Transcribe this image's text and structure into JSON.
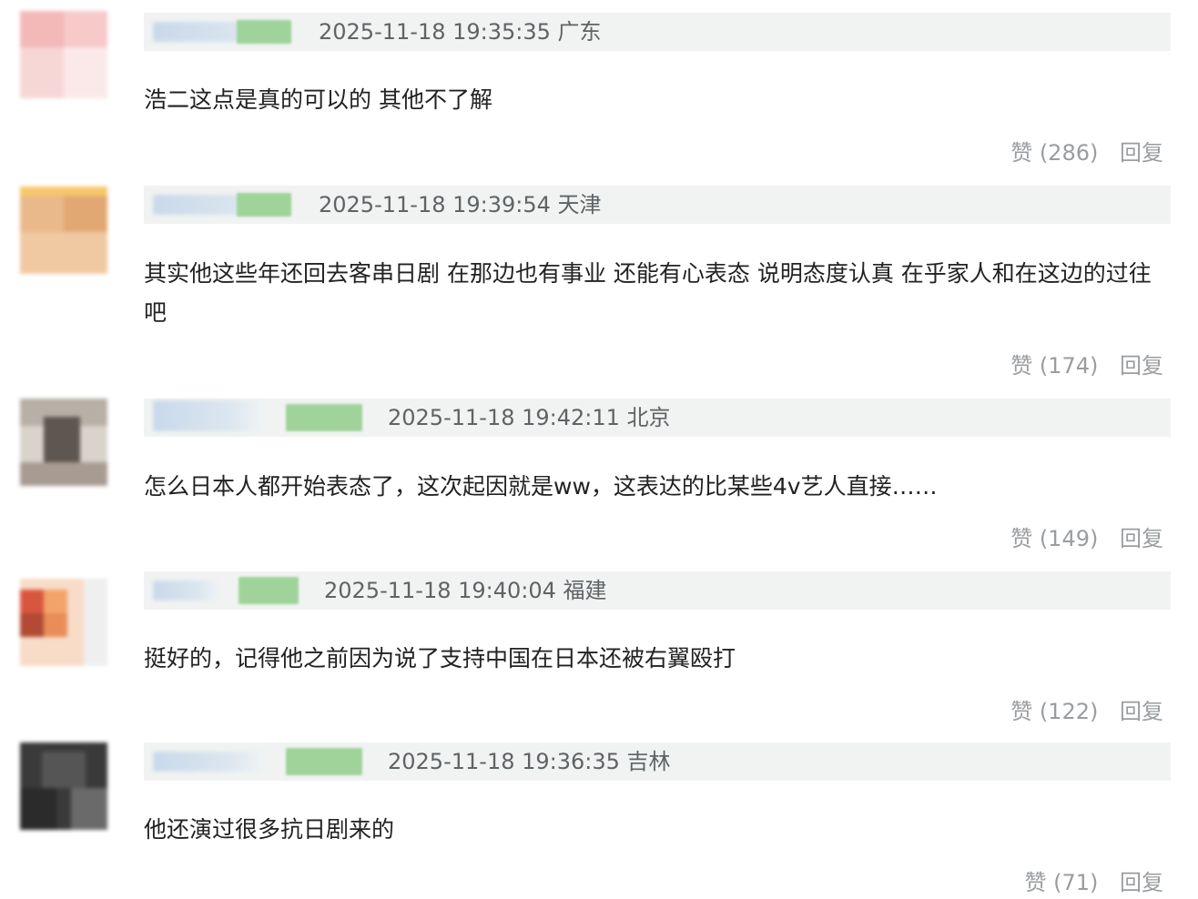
{
  "comments": [
    {
      "time_location": "2025-11-18 19:35:35 广东",
      "text": "浩二这点是真的可以的 其他不了解",
      "like_label": "赞 (286)",
      "reply_label": "回复",
      "avatar_colors": [
        "#f3b8b8",
        "#f7d6d6",
        "#fbe9e9"
      ]
    },
    {
      "time_location": "2025-11-18 19:39:54 天津",
      "text": "其实他这些年还回去客串日剧 在那边也有事业 还能有心表态 说明态度认真 在乎家人和在这边的过往吧",
      "like_label": "赞 (174)",
      "reply_label": "回复",
      "avatar_colors": [
        "#e9b98a",
        "#f1d4b3",
        "#f6c890"
      ]
    },
    {
      "time_location": "2025-11-18 19:42:11 北京",
      "text": "怎么日本人都开始表态了，这次起因就是ww，这表达的比某些4v艺人直接……",
      "like_label": "赞 (149)",
      "reply_label": "回复",
      "avatar_colors": [
        "#a89c92",
        "#5e5650",
        "#d9d3cc"
      ]
    },
    {
      "time_location": "2025-11-18 19:40:04 福建",
      "text": "挺好的，记得他之前因为说了支持中国在日本还被右翼殴打",
      "like_label": "赞 (122)",
      "reply_label": "回复",
      "avatar_colors": [
        "#d9563e",
        "#f2a36a",
        "#f8dcc8"
      ]
    },
    {
      "time_location": "2025-11-18 19:36:35 吉林",
      "text": "他还演过很多抗日剧来的",
      "like_label": "赞 (71)",
      "reply_label": "回复",
      "avatar_colors": [
        "#2b2b2b",
        "#555555",
        "#8a8a8a"
      ]
    }
  ]
}
